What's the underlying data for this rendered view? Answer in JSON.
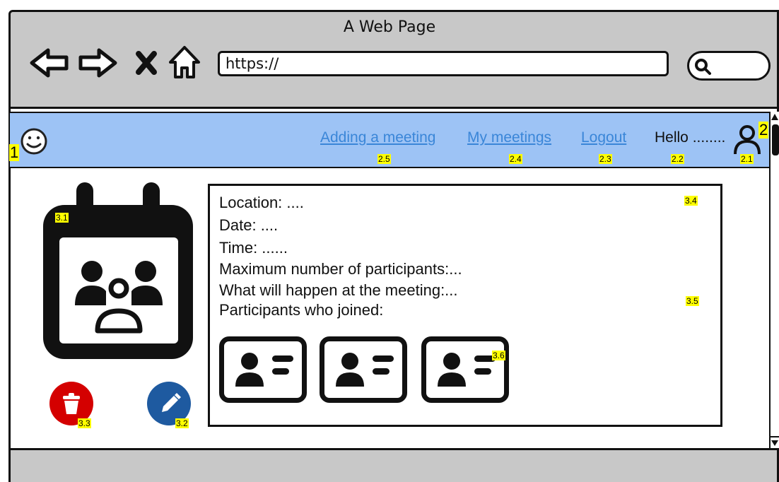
{
  "browser": {
    "title": "A Web Page",
    "url": "https://",
    "icons": {
      "back": "back-arrow-icon",
      "forward": "forward-arrow-icon",
      "stop": "close-icon",
      "home": "home-icon",
      "search": "search-icon"
    }
  },
  "header": {
    "logo_icon": "smiley-icon",
    "nav": {
      "add_meeting": "Adding a meeting",
      "my_meetings": "My meetings",
      "logout": "Logout"
    },
    "greeting": "Hello ........",
    "user_icon": "user-icon",
    "color": "#9dc3f5",
    "link_color": "#3a86d8"
  },
  "markers": {
    "m1": "1",
    "m2": "2",
    "m2_1": "2.1",
    "m2_2": "2.2",
    "m2_3": "2.3",
    "m2_4": "2.4",
    "m2_5": "2.5",
    "m3_1": "3.1",
    "m3_2": "3.2",
    "m3_3": "3.3",
    "m3_4": "3.4",
    "m3_5": "3.5",
    "m3_6": "3.6"
  },
  "meeting": {
    "icon": "calendar-group-icon",
    "location": "Location: ....",
    "date": "Date: ....",
    "time": "Time: ......",
    "max_participants": "Maximum number of participants:...",
    "what_happens": "What will happen at the meeting:...",
    "participants_label": "Participants who joined:",
    "participant_card_icon": "contact-card-icon",
    "participants_count": 3
  },
  "actions": {
    "delete_icon": "trash-icon",
    "delete_color": "#d40000",
    "edit_icon": "pencil-icon",
    "edit_color": "#1e5aa0"
  }
}
